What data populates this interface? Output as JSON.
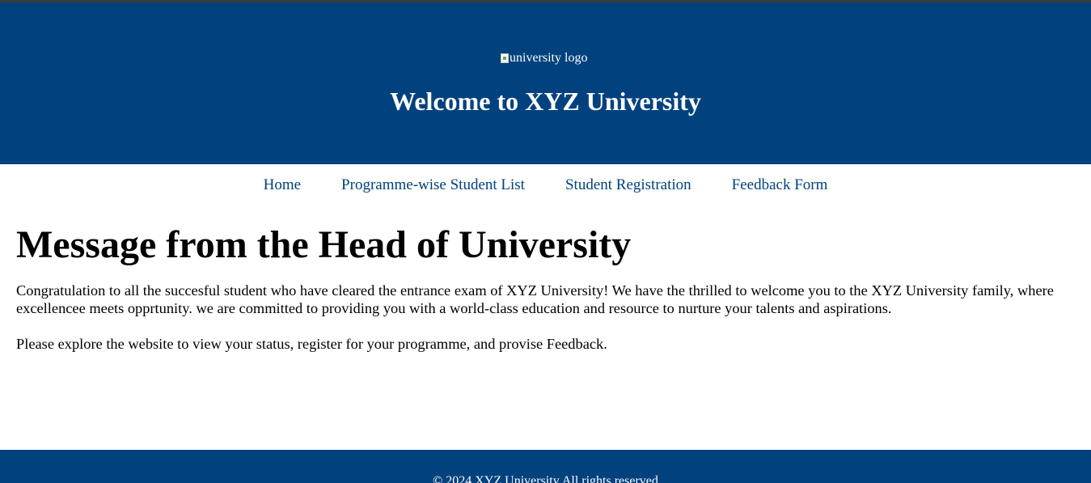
{
  "header": {
    "logo_alt": "university logo",
    "title": "Welcome to XYZ University",
    "background_color": "#00417e"
  },
  "nav": {
    "items": [
      {
        "label": "Home"
      },
      {
        "label": "Programme-wise Student List"
      },
      {
        "label": "Student Registration"
      },
      {
        "label": "Feedback Form"
      }
    ],
    "link_color": "#00417e"
  },
  "main": {
    "heading": "Message from the Head of University",
    "paragraph1": "Congratulation to all the succesful student who have cleared the entrance exam of XYZ University! We have the thrilled to welcome you to the XYZ University family, where excellencee meets opprtunity. we are committed to providing you with a world-class education and resource to nurture your talents and aspirations.",
    "paragraph2": "Please explore the website to view your status, register for your programme, and provise Feedback."
  },
  "footer": {
    "text": "© 2024 XYZ University All rights reserved"
  }
}
